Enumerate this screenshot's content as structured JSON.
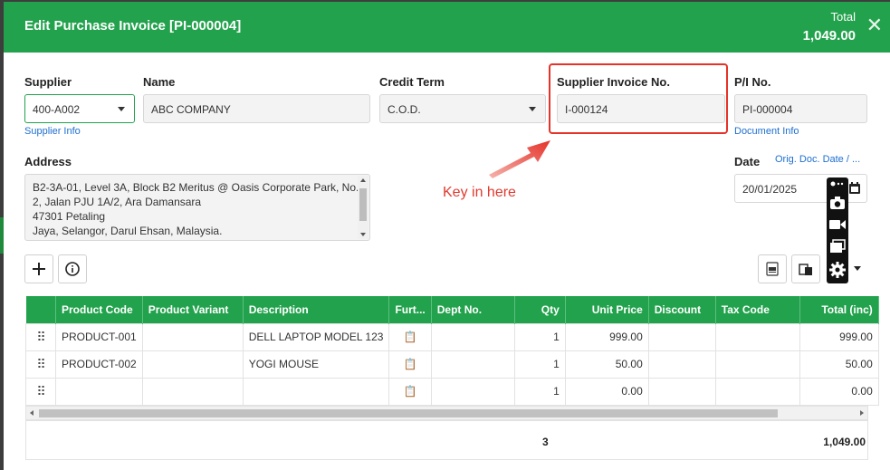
{
  "header": {
    "title": "Edit Purchase Invoice [PI-000004]",
    "total_label": "Total",
    "total_value": "1,049.00"
  },
  "form": {
    "supplier_label": "Supplier",
    "supplier_value": "400-A002",
    "supplier_info_link": "Supplier Info",
    "name_label": "Name",
    "name_value": "ABC COMPANY",
    "credit_term_label": "Credit Term",
    "credit_term_value": "C.O.D.",
    "supplier_invoice_label": "Supplier Invoice No.",
    "supplier_invoice_value": "I-000124",
    "pi_no_label": "P/I No.",
    "pi_no_value": "PI-000004",
    "document_info_link": "Document Info",
    "address_label": "Address",
    "address_lines": [
      "B2-3A-01, Level 3A, Block B2 Meritus @ Oasis Corporate Park, No.",
      "2, Jalan PJU 1A/2, Ara Damansara",
      "47301 Petaling",
      "Jaya, Selangor, Darul Ehsan, Malaysia."
    ],
    "date_label": "Date",
    "orig_doc_link": "Orig. Doc. Date / ...",
    "date_value": "20/01/2025"
  },
  "annotation": {
    "text": "Key in here",
    "color": "#e03a2f"
  },
  "table": {
    "columns": [
      "",
      "Product Code",
      "Product Variant",
      "Description",
      "Furt...",
      "Dept No.",
      "Qty",
      "Unit Price",
      "Discount",
      "Tax Code",
      "Total (inc)"
    ],
    "rows": [
      {
        "product_code": "PRODUCT-001",
        "variant": "",
        "description": "DELL LAPTOP MODEL 123",
        "dept": "",
        "qty": "1",
        "unit_price": "999.00",
        "discount": "",
        "tax_code": "",
        "total": "999.00"
      },
      {
        "product_code": "PRODUCT-002",
        "variant": "",
        "description": "YOGI MOUSE",
        "dept": "",
        "qty": "1",
        "unit_price": "50.00",
        "discount": "",
        "tax_code": "",
        "total": "50.00"
      },
      {
        "product_code": "",
        "variant": "",
        "description": "",
        "dept": "",
        "qty": "1",
        "unit_price": "0.00",
        "discount": "",
        "tax_code": "",
        "total": "0.00"
      }
    ],
    "footer_qty": "3",
    "footer_total": "1,049.00"
  },
  "colors": {
    "accent": "#23a24d",
    "highlight": "#e5332a",
    "link": "#1d6fd0"
  },
  "icons": [
    "close-icon",
    "caret-down-icon",
    "plus-icon",
    "info-icon",
    "xlsx-icon",
    "copy-doc-icon",
    "calendar-icon",
    "camera-icon",
    "video-icon",
    "layers-icon",
    "gear-icon",
    "drag-handle-icon",
    "clipboard-icon"
  ]
}
